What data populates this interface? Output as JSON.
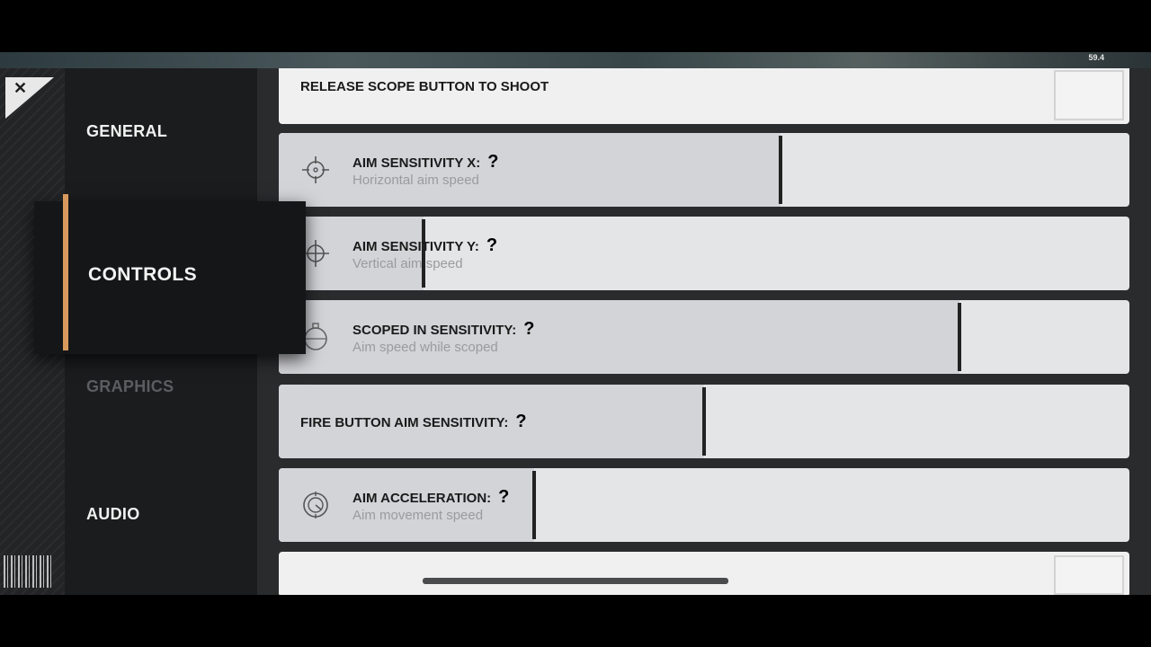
{
  "hud": {
    "fps": "59.4"
  },
  "close": {
    "glyph": "✕",
    "icon": "close-icon"
  },
  "nav": {
    "items": [
      {
        "label": "GENERAL"
      },
      {
        "label": "CONTROLS",
        "active": true
      },
      {
        "label": "GRAPHICS",
        "disabled": true
      },
      {
        "label": "AUDIO"
      }
    ],
    "accent_color": "#d79a5c"
  },
  "settings": {
    "release_scope": {
      "label": "RELEASE SCOPE BUTTON TO SHOOT"
    },
    "aim_x": {
      "label": "AIM SENSITIVITY X:",
      "sub": "Horizontal aim speed",
      "help": "?",
      "icon": "crosshair-icon",
      "value_fraction": 0.59
    },
    "aim_y": {
      "label": "AIM SENSITIVITY Y:",
      "sub": "Vertical aim speed",
      "help": "?",
      "icon": "crosshair-icon",
      "value_fraction": 0.17
    },
    "scoped": {
      "label": "SCOPED IN SENSITIVITY:",
      "sub": "Aim speed while scoped",
      "help": "?",
      "icon": "scope-icon",
      "value_fraction": 0.8
    },
    "fire_button": {
      "label": "FIRE BUTTON AIM SENSITIVITY:",
      "help": "?",
      "value_fraction": 0.5
    },
    "acceleration": {
      "label": "AIM ACCELERATION:",
      "sub": "Aim movement speed",
      "help": "?",
      "icon": "target-icon",
      "value_fraction": 0.3
    }
  }
}
